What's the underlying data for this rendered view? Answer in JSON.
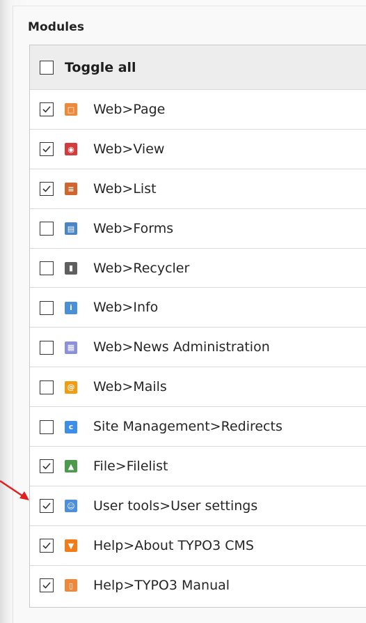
{
  "section": {
    "heading": "Modules"
  },
  "toggle_all": {
    "label": "Toggle all",
    "checked": false
  },
  "modules": [
    {
      "label": "Web>Page",
      "checked": true,
      "icon": "page-icon",
      "icon_color": "#f0883a"
    },
    {
      "label": "Web>View",
      "checked": true,
      "icon": "view-eye-icon",
      "icon_color": "#d63b3b"
    },
    {
      "label": "Web>List",
      "checked": true,
      "icon": "list-icon",
      "icon_color": "#d1652f"
    },
    {
      "label": "Web>Forms",
      "checked": false,
      "icon": "forms-icon",
      "icon_color": "#4a86c5"
    },
    {
      "label": "Web>Recycler",
      "checked": false,
      "icon": "trash-icon",
      "icon_color": "#5f5f5f"
    },
    {
      "label": "Web>Info",
      "checked": false,
      "icon": "info-icon",
      "icon_color": "#4a90d9"
    },
    {
      "label": "Web>News Administration",
      "checked": false,
      "icon": "news-icon",
      "icon_color": "#8c90d9"
    },
    {
      "label": "Web>Mails",
      "checked": false,
      "icon": "mail-icon",
      "icon_color": "#f39c12"
    },
    {
      "label": "Site Management>Redirects",
      "checked": false,
      "icon": "redirect-icon",
      "icon_color": "#3d8ee6"
    },
    {
      "label": "File>Filelist",
      "checked": true,
      "icon": "filelist-icon",
      "icon_color": "#4c9a4c"
    },
    {
      "label": "User tools>User settings",
      "checked": true,
      "icon": "user-settings-icon",
      "icon_color": "#4a8fe0"
    },
    {
      "label": "Help>About TYPO3 CMS",
      "checked": true,
      "icon": "typo3-icon",
      "icon_color": "#f37c1a"
    },
    {
      "label": "Help>TYPO3 Manual",
      "checked": true,
      "icon": "manual-icon",
      "icon_color": "#f0883a"
    }
  ],
  "colors": {
    "arrow": "#e02020",
    "check": "#333333"
  }
}
